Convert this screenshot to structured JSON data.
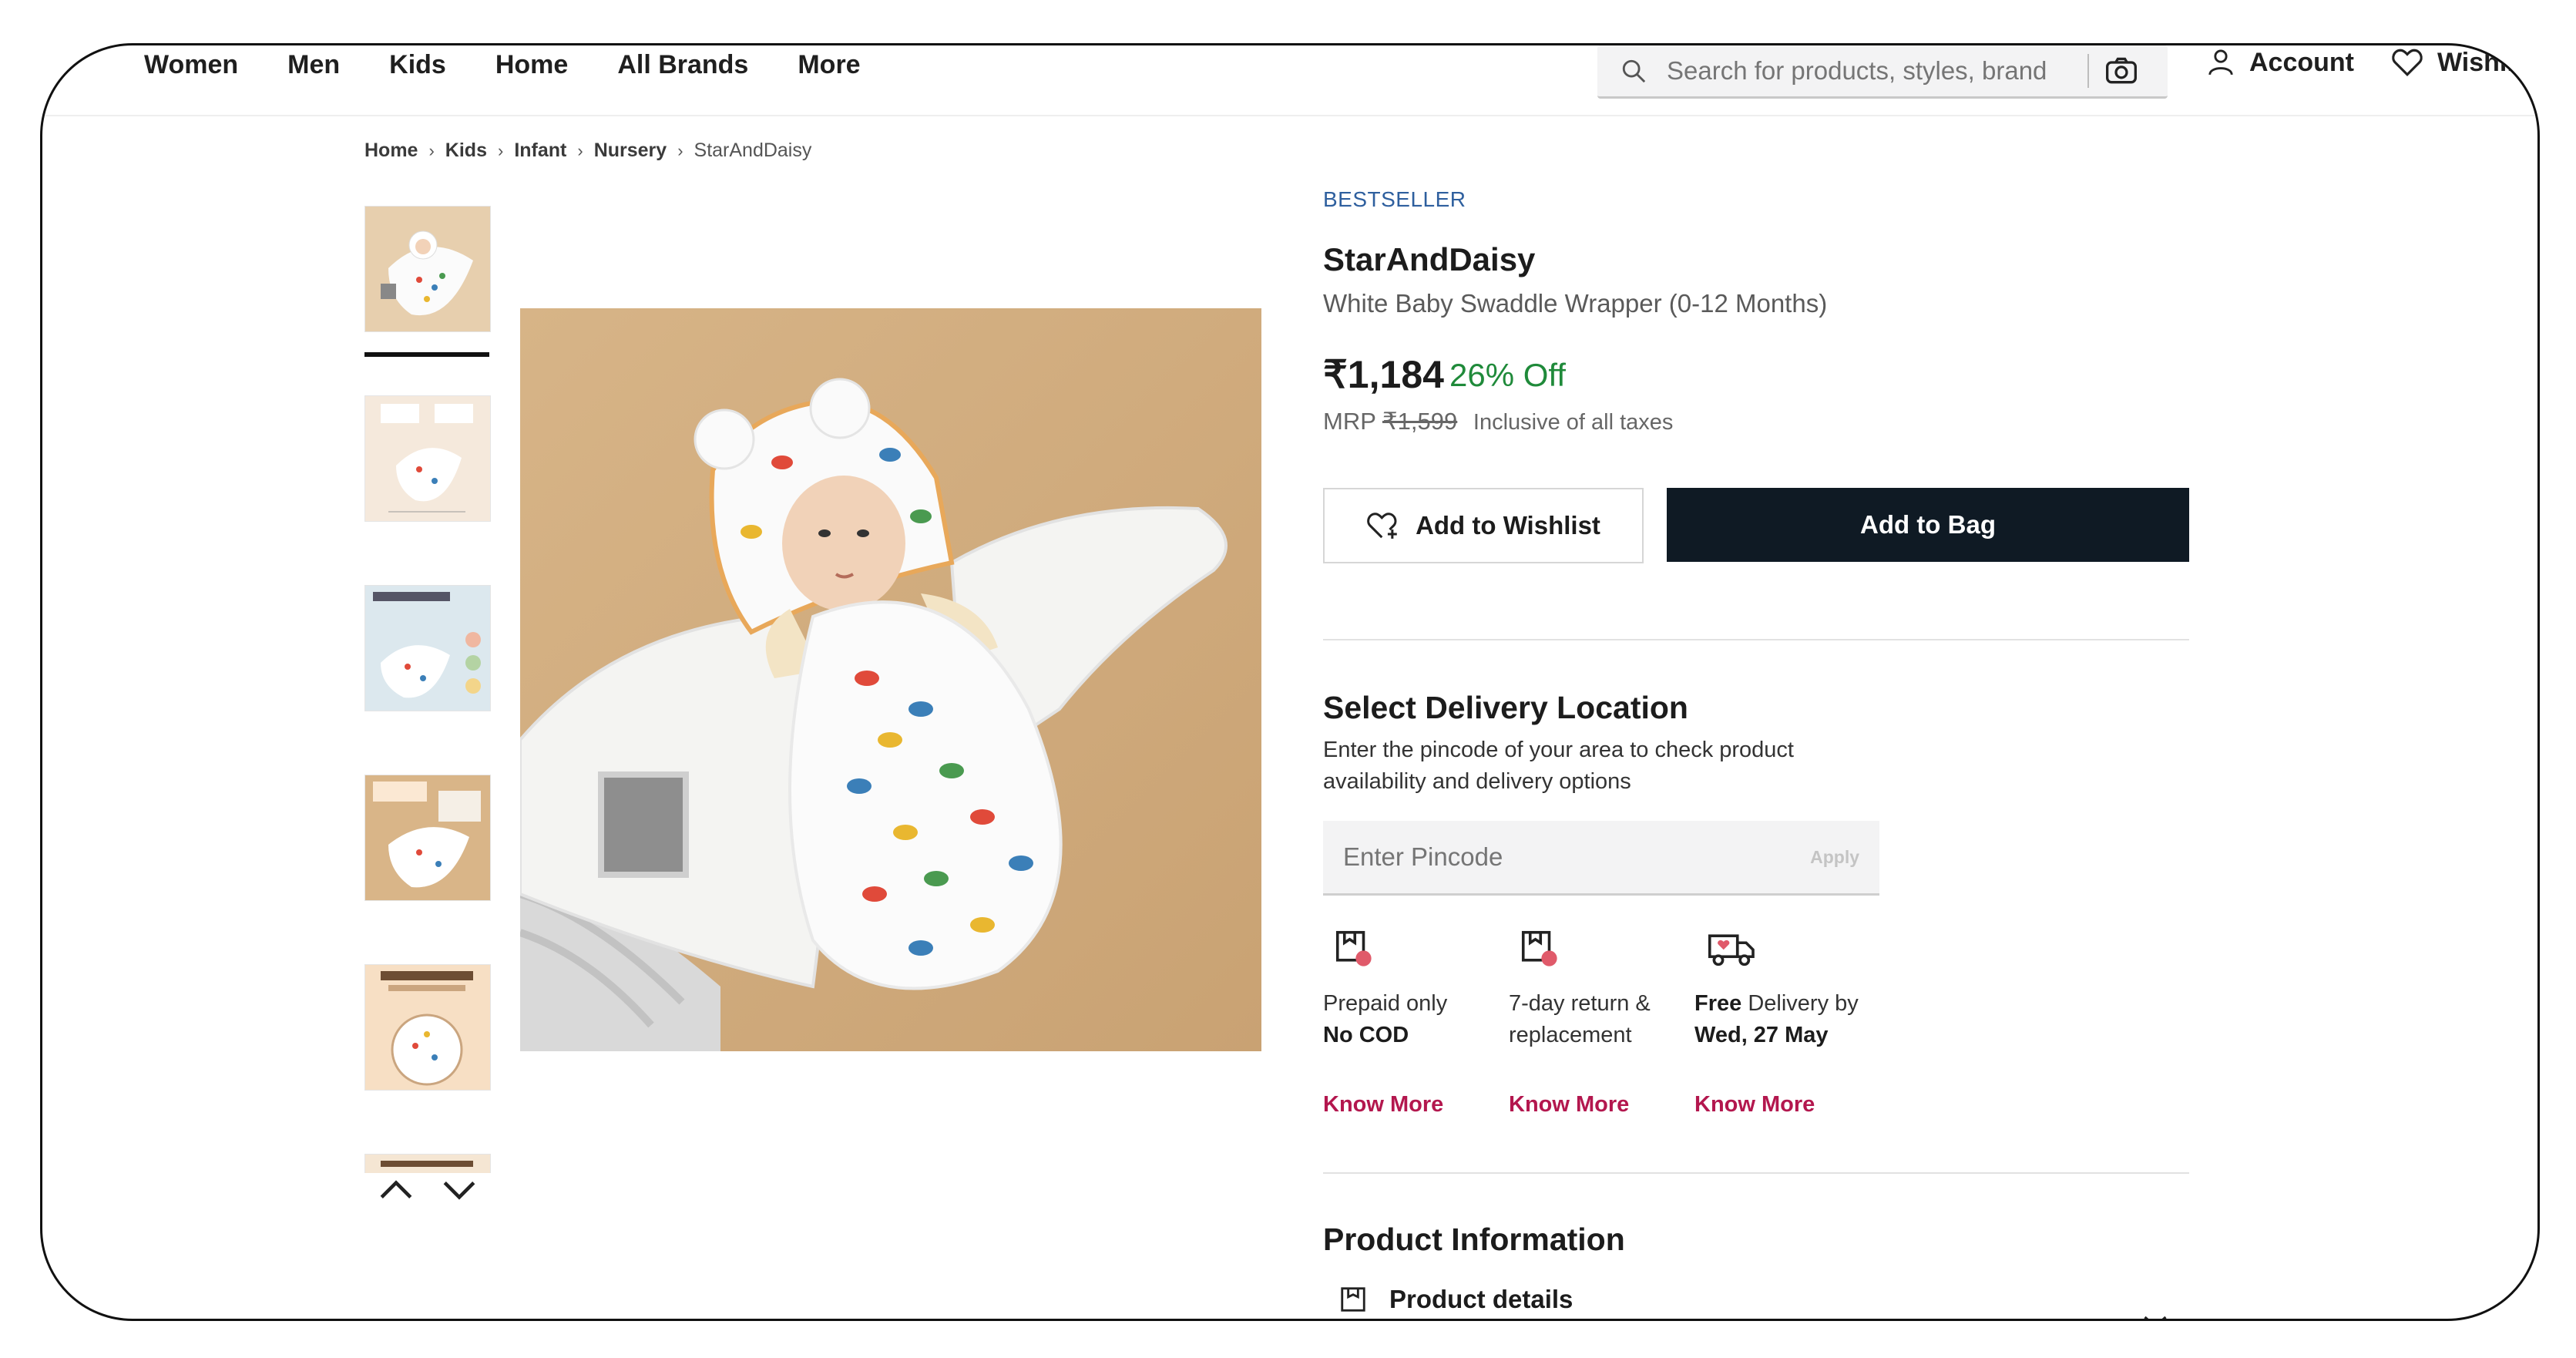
{
  "header": {
    "nav": [
      "Women",
      "Men",
      "Kids",
      "Home",
      "All Brands",
      "More"
    ],
    "search_placeholder": "Search for products, styles, brand",
    "account_label": "Account",
    "wishlist_label": "Wishlist"
  },
  "breadcrumb": [
    "Home",
    "Kids",
    "Infant",
    "Nursery",
    "StarAndDaisy"
  ],
  "product": {
    "badge": "BESTSELLER",
    "brand": "StarAndDaisy",
    "name": "White Baby Swaddle Wrapper (0-12 Months)",
    "price": "₹1,184",
    "discount": "26% Off",
    "mrp_label": "MRP",
    "mrp_value": "₹1,599",
    "tax_note": "Inclusive of all taxes"
  },
  "buttons": {
    "wishlist": "Add to Wishlist",
    "bag": "Add to Bag"
  },
  "delivery": {
    "title": "Select Delivery Location",
    "description": "Enter the pincode of your area to check product availability and delivery options",
    "pincode_placeholder": "Enter Pincode",
    "apply": "Apply",
    "features": [
      {
        "line1": "Prepaid only",
        "line2": "No COD",
        "link": "Know More"
      },
      {
        "line1": "7-day return &",
        "line2": "replacement",
        "link": "Know More"
      },
      {
        "pre": "Free",
        "mid": " Delivery by ",
        "date": "Wed, 27 May",
        "link": "Know More"
      }
    ]
  },
  "product_info": {
    "title": "Product Information",
    "details_label": "Product details"
  },
  "colors": {
    "accent_link": "#b3174e",
    "discount": "#1f8a3a",
    "bestseller": "#2e5f9e",
    "bag_button": "#0f1a24"
  }
}
